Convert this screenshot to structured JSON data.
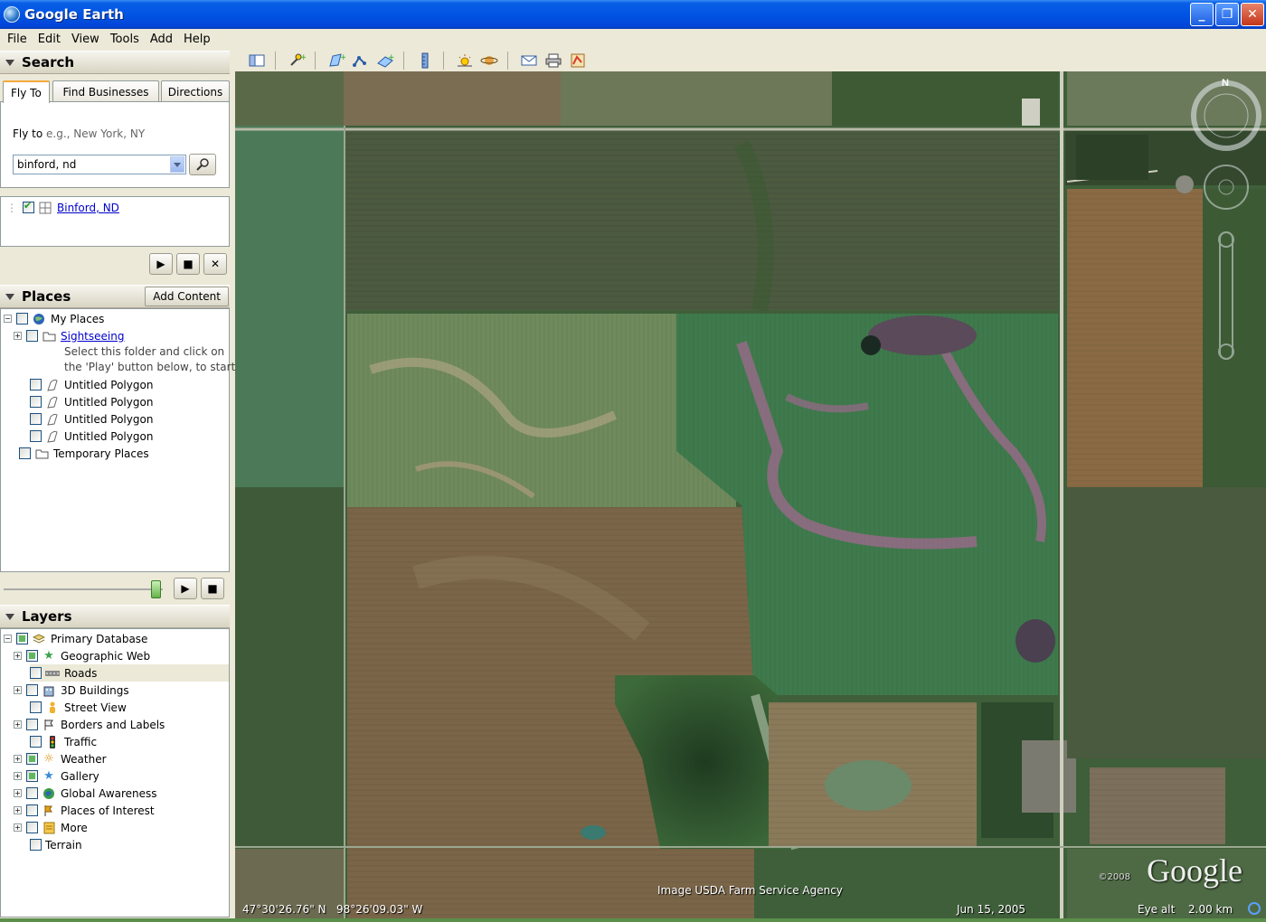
{
  "window": {
    "title": "Google Earth"
  },
  "menu": [
    "File",
    "Edit",
    "View",
    "Tools",
    "Add",
    "Help"
  ],
  "search": {
    "header": "Search",
    "tabs": [
      "Fly To",
      "Find Businesses",
      "Directions"
    ],
    "fly_label": "Fly to",
    "fly_hint": "e.g., New York, NY",
    "query": "binford, nd",
    "result": "Binford, ND"
  },
  "places": {
    "header": "Places",
    "add_content": "Add Content",
    "items": {
      "my_places": "My Places",
      "sightseeing": "Sightseeing",
      "hint1": "Select this folder and click on",
      "hint2": "the 'Play' button below, to start",
      "poly1": "Untitled Polygon",
      "poly2": "Untitled Polygon",
      "poly3": "Untitled Polygon",
      "poly4": "Untitled Polygon",
      "temp": "Temporary Places"
    }
  },
  "layers": {
    "header": "Layers",
    "items": {
      "primary": "Primary Database",
      "geoweb": "Geographic Web",
      "roads": "Roads",
      "buildings": "3D Buildings",
      "streetview": "Street View",
      "borders": "Borders and Labels",
      "traffic": "Traffic",
      "weather": "Weather",
      "gallery": "Gallery",
      "awareness": "Global Awareness",
      "poi": "Places of Interest",
      "more": "More",
      "terrain": "Terrain"
    }
  },
  "map": {
    "lat": "47°30'26.76\" N",
    "lon": "98°26'09.03\" W",
    "credit": "Image USDA Farm Service Agency",
    "date": "Jun 15, 2005",
    "eye_label": "Eye alt",
    "eye_value": "2.00 km",
    "copyright": "©2008",
    "logo": "Google",
    "north": "N"
  }
}
